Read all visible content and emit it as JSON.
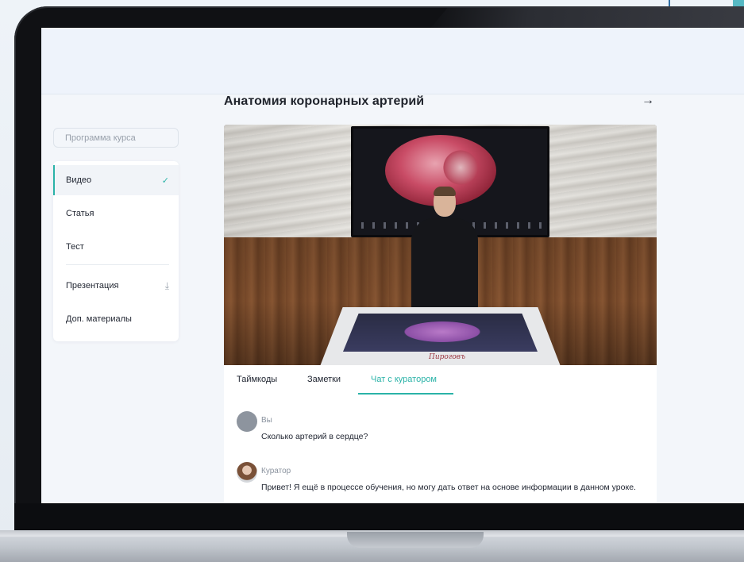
{
  "lesson": {
    "title": "Анатомия коронарных артерий",
    "next_arrow": "→"
  },
  "sidebar": {
    "search_placeholder": "Программа курса",
    "items": [
      {
        "label": "Видео",
        "state": "completed",
        "icon": "check-icon"
      },
      {
        "label": "Статья"
      },
      {
        "label": "Тест"
      },
      {
        "label": "Презентация",
        "icon": "download-icon"
      },
      {
        "label": "Доп. материалы"
      }
    ],
    "check_glyph": "✓",
    "download_glyph": "⤓"
  },
  "tabs": [
    {
      "label": "Таймкоды"
    },
    {
      "label": "Заметки"
    },
    {
      "label": "Чат с куратором",
      "active": true
    }
  ],
  "chat": {
    "messages": [
      {
        "author": "Вы",
        "text": "Сколько артерий в сердце?"
      },
      {
        "author": "Куратор",
        "text": "Привет! Я ещё в процессе обучения, но могу дать ответ на основе информации в данном уроке."
      }
    ]
  },
  "video": {
    "table_logo": "Пироговъ"
  },
  "colors": {
    "accent": "#2bb3a8",
    "text": "#1f2430",
    "muted": "#8a929e"
  }
}
